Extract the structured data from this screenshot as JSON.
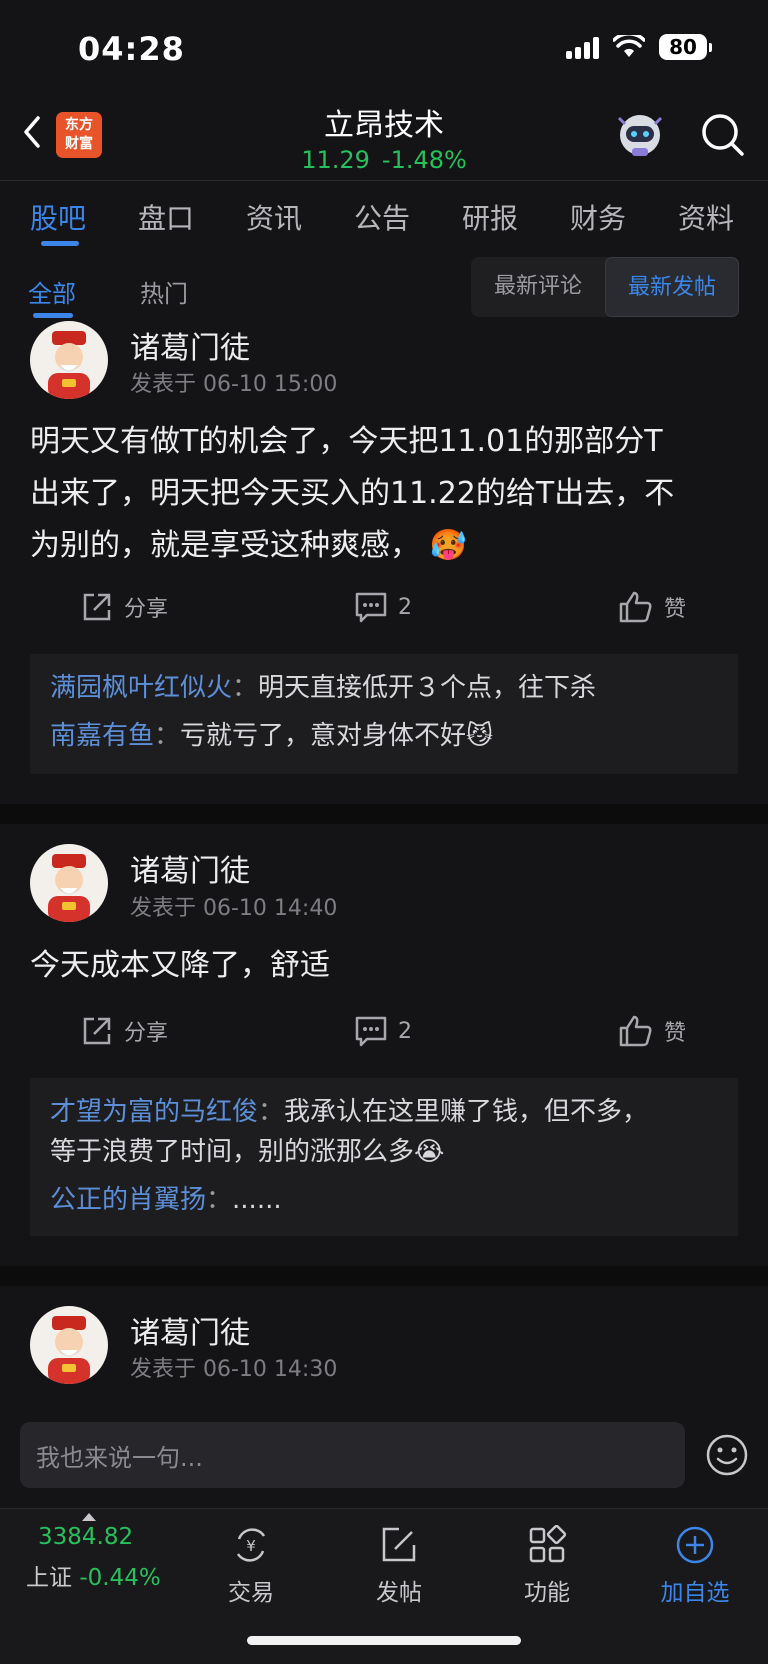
{
  "status_bar": {
    "time": "04:28",
    "battery": "80"
  },
  "header": {
    "logo_line1": "东方",
    "logo_line2": "财富",
    "title": "立昂技术",
    "price": "11.29",
    "change": "-1.48%"
  },
  "tabs": [
    "股吧",
    "盘口",
    "资讯",
    "公告",
    "研报",
    "财务",
    "资料"
  ],
  "subtabs": {
    "all": "全部",
    "hot": "热门",
    "latest_comment": "最新评论",
    "latest_post": "最新发帖"
  },
  "posts": [
    {
      "author": "诸葛门徒",
      "time": "发表于 06-10 15:00",
      "line1": "明天又有做T的机会了，今天把11.01的那部分T",
      "line2": "出来了，明天把今天买入的11.22的给T出去，不",
      "line3": "为别的，就是享受这种爽感，",
      "emoji": "🥵",
      "share": "分享",
      "comments": "2",
      "like": "赞",
      "replies": [
        {
          "name": "满园枫叶红似火",
          "text": "明天直接低开３个点，往下杀"
        },
        {
          "name": "南嘉有鱼",
          "text": "亏就亏了，意对身体不好",
          "emoji": "😼"
        }
      ]
    },
    {
      "author": "诸葛门徒",
      "time": "发表于 06-10 14:40",
      "line1": "今天成本又降了，舒适",
      "share": "分享",
      "comments": "2",
      "like": "赞",
      "replies": [
        {
          "name": "才望为富的马红俊",
          "text": "我承认在这里赚了钱，但不多，",
          "text2": "等于浪费了时间，别的涨那么多",
          "emoji": "😭"
        },
        {
          "name": "公正的肖翼扬",
          "text": "......"
        }
      ]
    },
    {
      "author": "诸葛门徒",
      "time": "发表于 06-10 14:30"
    }
  ],
  "comment_bar": {
    "placeholder": "我也来说一句..."
  },
  "bottom_nav": {
    "index_value": "3384.82",
    "index_name": "上证",
    "index_change": "-0.44%",
    "items": [
      "交易",
      "发帖",
      "功能",
      "加自选"
    ]
  },
  "colors": {
    "accent": "#3b86e8",
    "down_green": "#26c15c",
    "background": "#141416"
  }
}
